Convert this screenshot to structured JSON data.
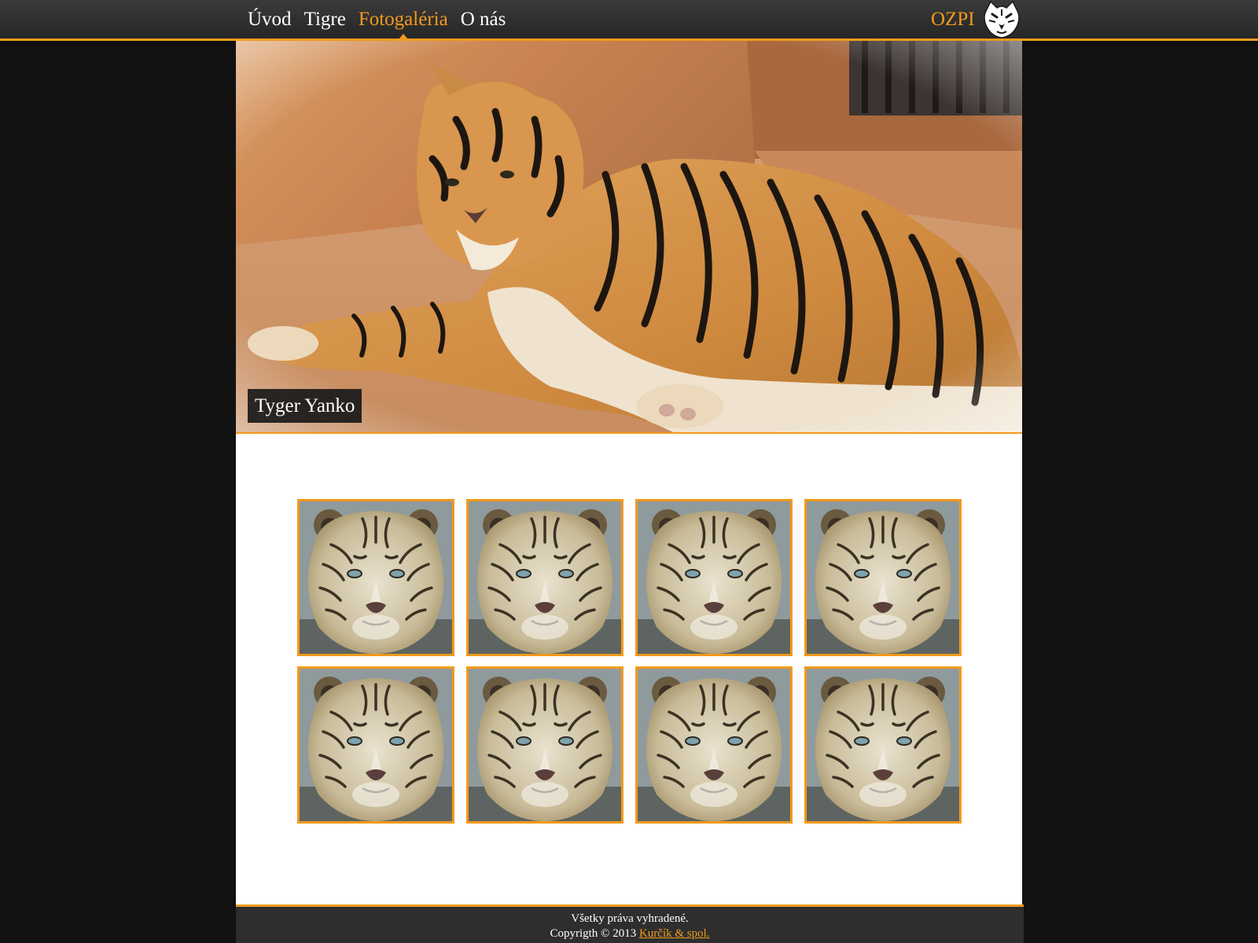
{
  "nav": {
    "items": [
      {
        "label": "Úvod",
        "active": false
      },
      {
        "label": "Tigre",
        "active": false
      },
      {
        "label": "Fotogaléria",
        "active": true
      },
      {
        "label": "O nás",
        "active": false
      }
    ]
  },
  "brand": {
    "name": "OZPI",
    "logo_icon": "tiger-head-logo"
  },
  "hero": {
    "caption": "Tyger Yanko",
    "image": "reclining-bengal-tiger-photo"
  },
  "gallery": {
    "thumbnails": [
      {
        "image": "white-tiger-face-photo"
      },
      {
        "image": "white-tiger-face-photo"
      },
      {
        "image": "white-tiger-face-photo"
      },
      {
        "image": "white-tiger-face-photo"
      },
      {
        "image": "white-tiger-face-photo"
      },
      {
        "image": "white-tiger-face-photo"
      },
      {
        "image": "white-tiger-face-photo"
      },
      {
        "image": "white-tiger-face-photo"
      }
    ]
  },
  "footer": {
    "rights": "Všetky práva vyhradené.",
    "copyright_prefix": "Copyrigth © 2013",
    "link_label": "Kurčík & spol."
  },
  "colors": {
    "accent": "#f29a1c",
    "page_bg": "#121212",
    "bar_bg": "#2e2e2e",
    "content_bg": "#ffffff"
  }
}
